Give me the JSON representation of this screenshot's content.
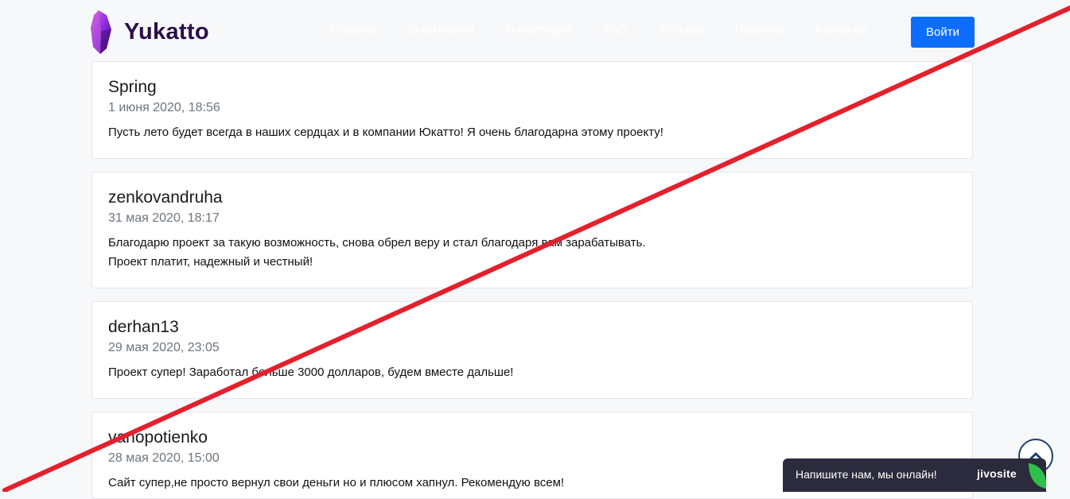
{
  "header": {
    "logo_text": "Yukatto",
    "nav": [
      "Главная",
      "О компании",
      "Инвестиции",
      "FAQ",
      "Отзывы",
      "Правила",
      "Контакты"
    ],
    "login_label": "Войти"
  },
  "reviews": [
    {
      "name": "Spring",
      "date": "1 июня 2020, 18:56",
      "lines": [
        "Пусть лето будет всегда в наших сердцах и в компании Юкатто! Я очень благодарна этому проекту!"
      ]
    },
    {
      "name": "zenkovandruha",
      "date": "31 мая 2020, 18:17",
      "lines": [
        "Благодарю проект за такую возможность, снова обрел веру и стал благодаря вам зарабатывать.",
        "Проект платит, надежный и честный!"
      ]
    },
    {
      "name": "derhan13",
      "date": "29 мая 2020, 23:05",
      "lines": [
        "Проект супер! Заработал больше 3000 долларов, будем вместе дальше!"
      ]
    },
    {
      "name": "vanopotienko",
      "date": "28 мая 2020, 15:00",
      "lines": [
        "Сайт супер,не просто вернул свои деньги но и плюсом хапнул. Рекомендую всем!"
      ]
    }
  ],
  "chat": {
    "label": "Напишите нам, мы онлайн!",
    "brand": "jivosite"
  },
  "icons": {
    "logo": "purple-crystal-icon",
    "scroll_top": "chevron-up-icon",
    "chat_leaf": "green-leaf-icon"
  },
  "colors": {
    "brand_text": "#2a0d4a",
    "login_button": "#0d6efd",
    "strike_line": "#e3202c",
    "chat_bg": "#2b2b3d",
    "scroll_ring": "#1b3f73"
  }
}
